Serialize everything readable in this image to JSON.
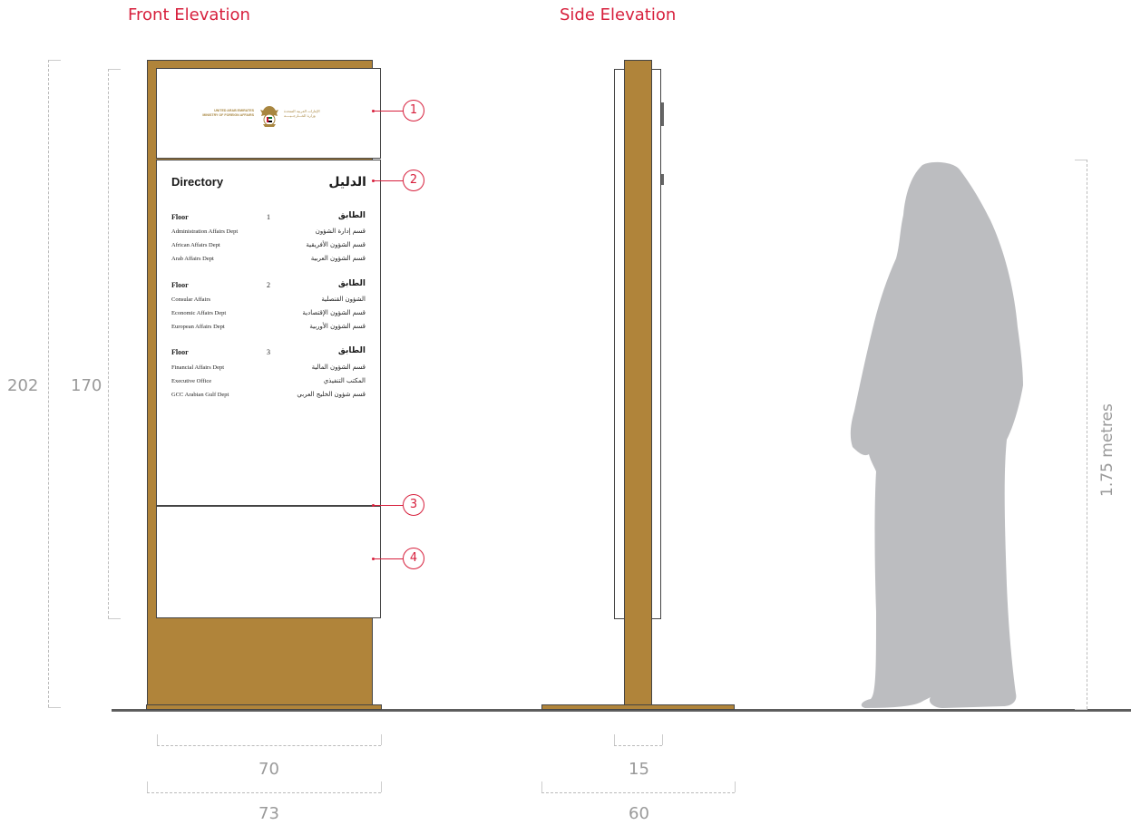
{
  "headings": {
    "front": "Front Elevation",
    "side": "Side Elevation"
  },
  "dimensions": {
    "total_height": "202",
    "panel_height": "170",
    "front_inner_width": "70",
    "front_outer_width": "73",
    "side_post_width": "15",
    "side_base_width": "60",
    "person_height": "1.75 metres"
  },
  "callouts": [
    "1",
    "2",
    "3",
    "4"
  ],
  "logo": {
    "en_line1": "UNITED ARAB EMIRATES",
    "en_line2": "MINISTRY OF FOREIGN AFFAIRS",
    "ar_line1": "الإمارات العربية المتحدة",
    "ar_line2": "وزارة الخـــارجــيــــة"
  },
  "directory": {
    "title_en": "Directory",
    "title_ar": "الدليل",
    "floors": [
      {
        "label_en": "Floor",
        "number": "1",
        "label_ar": "الطابق",
        "depts": [
          {
            "en": "Administration Affairs Dept",
            "ar": "قسم إدارة الشؤون"
          },
          {
            "en": "African Affairs Dept",
            "ar": "قسم الشؤون الأفريقية"
          },
          {
            "en": "Arab Affairs Dept",
            "ar": "قسم الشؤون العربية"
          }
        ]
      },
      {
        "label_en": "Floor",
        "number": "2",
        "label_ar": "الطابق",
        "depts": [
          {
            "en": "Consular Affairs",
            "ar": "الشؤون القنصلية"
          },
          {
            "en": "Economic Affairs Dept",
            "ar": "قسم الشؤون الإقتصادية"
          },
          {
            "en": "European Affairs Dept",
            "ar": "قسم الشؤون الأوربية"
          }
        ]
      },
      {
        "label_en": "Floor",
        "number": "3",
        "label_ar": "الطابق",
        "depts": [
          {
            "en": "Financial Affairs Dept",
            "ar": "قسم الشؤون المالية"
          },
          {
            "en": "Executive Office",
            "ar": "المكتب التنفيذي"
          },
          {
            "en": "GCC Arabian Gulf Dept",
            "ar": "قسم شؤون الخليج العربي"
          }
        ]
      }
    ]
  },
  "colors": {
    "wood": "#b0843a",
    "accent": "#d71f3c",
    "person": "#bcbdc0",
    "dimension": "#9a9a9a"
  }
}
